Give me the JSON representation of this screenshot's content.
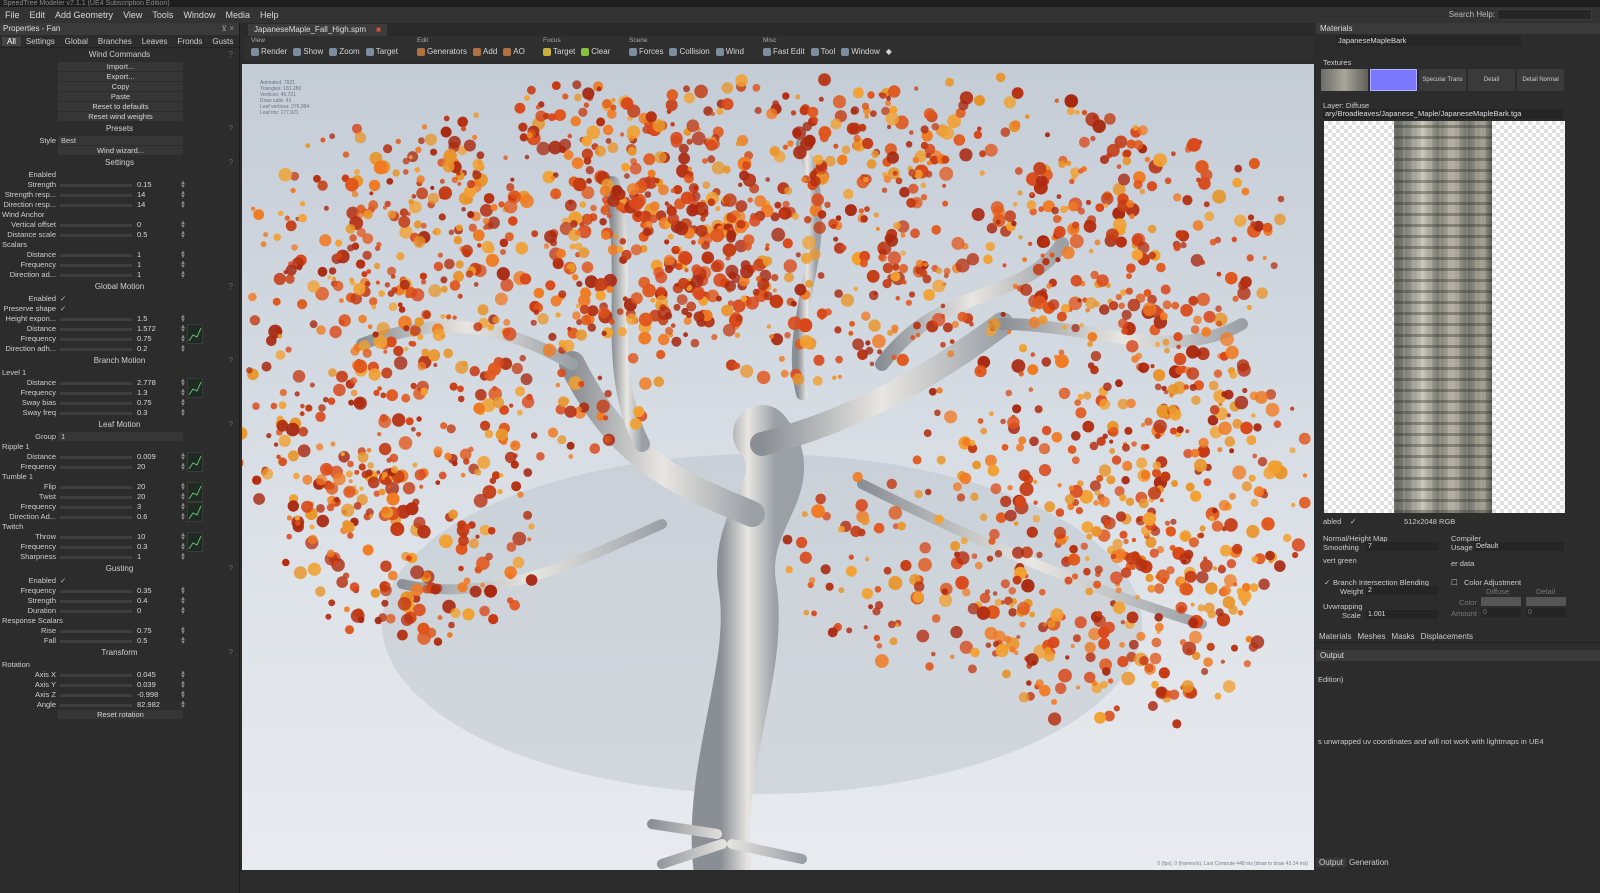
{
  "titlebar": {
    "text": "SpeedTree Modeler v7.1.1 (UE4 Subscription Edition)"
  },
  "menu": {
    "items": [
      "File",
      "Edit",
      "Add Geometry",
      "View",
      "Tools",
      "Window",
      "Media",
      "Help"
    ],
    "search_help": "Search Help:"
  },
  "left_panel": {
    "title": "Properties - Fan",
    "tabs": [
      "All",
      "Settings",
      "Global",
      "Branches",
      "Leaves",
      "Fronds",
      "Gusts"
    ],
    "wind_commands": {
      "title": "Wind Commands",
      "buttons": [
        "Import...",
        "Export...",
        "Copy",
        "Paste",
        "Reset to defaults",
        "Reset wind weights"
      ]
    },
    "presets": {
      "title": "Presets",
      "style_label": "Style",
      "style_value": "Best",
      "wizard": "Wind wizard..."
    },
    "settings": {
      "title": "Settings",
      "enabled": "Enabled",
      "rows": [
        {
          "label": "Strength",
          "value": "0.15",
          "fill": 0.15
        },
        {
          "label": "Strength resp...",
          "value": "14",
          "fill": 0.5
        },
        {
          "label": "Direction resp...",
          "value": "14",
          "fill": 0.5
        }
      ],
      "wind_anchor": "Wind Anchor",
      "anchor_rows": [
        {
          "label": "Vertical offset",
          "value": "0",
          "fill": 0.0
        },
        {
          "label": "Distance scale",
          "value": "0.5",
          "fill": 0.5
        }
      ],
      "scalars": "Scalars",
      "scalar_rows": [
        {
          "label": "Distance",
          "value": "1",
          "fill": 0.5
        },
        {
          "label": "Frequency",
          "value": "1",
          "fill": 0.5
        },
        {
          "label": "Direction ad...",
          "value": "1",
          "fill": 0.5
        }
      ]
    },
    "global_motion": {
      "title": "Global Motion",
      "enabled": "Enabled",
      "preserve": "Preserve shape",
      "rows": [
        {
          "label": "Height expon...",
          "value": "1.5",
          "fill": 0.5
        },
        {
          "label": "Distance",
          "value": "1.572",
          "fill": 0.5
        },
        {
          "label": "Frequency",
          "value": "0.75",
          "fill": 0.5
        },
        {
          "label": "Direction adh...",
          "value": "0.2",
          "fill": 0.2
        }
      ]
    },
    "branch_motion": {
      "title": "Branch Motion",
      "level": "Level 1",
      "rows": [
        {
          "label": "Distance",
          "value": "2.778",
          "fill": 0.5
        },
        {
          "label": "Frequency",
          "value": "1.3",
          "fill": 0.5
        },
        {
          "label": "Sway bias",
          "value": "0.75",
          "fill": 0.75
        },
        {
          "label": "Sway freq",
          "value": "0.3",
          "fill": 0.3
        }
      ]
    },
    "leaf_motion": {
      "title": "Leaf Motion",
      "group_label": "Group",
      "group_value": "1",
      "ripple": "Ripple 1",
      "ripple_rows": [
        {
          "label": "Distance",
          "value": "0.009",
          "fill": 0.05
        },
        {
          "label": "Frequency",
          "value": "20",
          "fill": 0.5
        }
      ],
      "tumble": "Tumble 1",
      "tumble_rows": [
        {
          "label": "Flip",
          "value": "20",
          "fill": 0.5
        },
        {
          "label": "Twist",
          "value": "20",
          "fill": 0.5
        },
        {
          "label": "Frequency",
          "value": "3",
          "fill": 0.3
        },
        {
          "label": "Direction Ad...",
          "value": "0.6",
          "fill": 0.6
        }
      ],
      "twitch": "Twitch",
      "twitch_rows": [
        {
          "label": "Throw",
          "value": "10",
          "fill": 0.5
        },
        {
          "label": "Frequency",
          "value": "0.3",
          "fill": 0.3
        },
        {
          "label": "Sharpness",
          "value": "1",
          "fill": 0.5
        }
      ]
    },
    "gusting": {
      "title": "Gusting",
      "enabled": "Enabled",
      "rows": [
        {
          "label": "Frequency",
          "value": "0.35",
          "fill": 0.35
        },
        {
          "label": "Strength",
          "value": "0.4",
          "fill": 0.4
        },
        {
          "label": "Duration",
          "value": "0",
          "fill": 0.0
        }
      ],
      "response": "Response Scalars",
      "response_rows": [
        {
          "label": "Rise",
          "value": "0.75",
          "fill": 0.5
        },
        {
          "label": "Fall",
          "value": "0.5",
          "fill": 0.5
        }
      ]
    },
    "transform": {
      "title": "Transform",
      "rotation": "Rotation",
      "rows": [
        {
          "label": "Axis X",
          "value": "0.045",
          "fill": 0.5
        },
        {
          "label": "Axis Y",
          "value": "0.039",
          "fill": 0.5
        },
        {
          "label": "Axis Z",
          "value": "-0.998",
          "fill": 0.5
        },
        {
          "label": "Angle",
          "value": "82.982",
          "fill": 0.5
        }
      ],
      "reset": "Reset rotation"
    }
  },
  "document": {
    "tab": "JapaneseMaple_Fall_High.spm"
  },
  "toolbar": {
    "groups": [
      {
        "label": "View",
        "buttons": [
          "Render",
          "Show",
          "Zoom",
          "Target"
        ]
      },
      {
        "label": "Edit",
        "buttons": [
          "Generators",
          "Add",
          "AO"
        ]
      },
      {
        "label": "Focus",
        "buttons": [
          "Target",
          "Clear"
        ]
      },
      {
        "label": "Scene",
        "buttons": [
          "Forces",
          "Collision",
          "Wind"
        ]
      },
      {
        "label": "Misc",
        "buttons": [
          "Fast Edit",
          "Tool",
          "Window"
        ]
      }
    ]
  },
  "viewport": {
    "stats": [
      "Animated: 7921",
      "Triangles: 181,280",
      "Vertices: 46,721",
      "Draw calls: 41",
      "Leaf vertices: 276,994",
      "Leaf tris: 177,921"
    ],
    "footer": "0 (fps), 0 (frames/s), Last Compute 448 ms (draw to draw 43.14 ms)"
  },
  "right_panel": {
    "title": "Materials",
    "material_name": "JapaneseMapleBark",
    "textures_label": "Textures",
    "slots": [
      "",
      "",
      "Specular Trans",
      "Detail",
      "Detail Normal"
    ],
    "layer": "Layer: Diffuse",
    "path": "ary/Broadleaves/Japanese_Maple/JapaneseMapleBark.tga",
    "tex_info": "512x2048 RGB",
    "enabled": "abled",
    "normal_map": "Normal/Height Map",
    "smoothing_label": "Smoothing",
    "smoothing_value": "7",
    "invert": "vert green",
    "compiler": "Compiler",
    "usage_label": "Usage",
    "usage_value": "Default",
    "er_data": "er data",
    "branch_blend": "Branch Intersection Blending",
    "weight_label": "Weight",
    "weight_value": "2",
    "uv_label": "Uvwrapping",
    "scale_label": "Scale",
    "scale_value": "1.001",
    "color_adj": "Color Adjustment",
    "diffuse": "Diffuse",
    "detail": "Detail",
    "color_label": "Color",
    "amount_label": "Amount",
    "amount_a": "0",
    "amount_b": "0",
    "tabs": [
      "Materials",
      "Meshes",
      "Masks",
      "Displacements"
    ],
    "output_title": "Output",
    "output_lines": [
      "Edition)",
      "s unwrapped uv coordinates and will not work with lightmaps in UE4"
    ],
    "bottom_tabs": [
      "Output",
      "Generation"
    ]
  }
}
